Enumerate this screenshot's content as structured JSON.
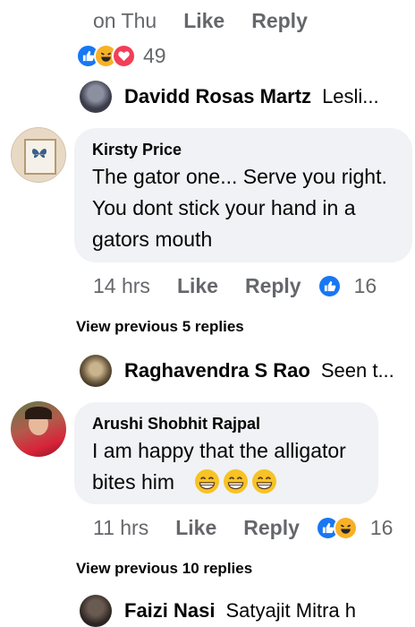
{
  "top_meta": {
    "time": "on Thu",
    "like": "Like",
    "reply": "Reply"
  },
  "top_reactions": {
    "icons": [
      "like-icon",
      "haha-icon",
      "love-icon"
    ],
    "count": "49"
  },
  "reply_preview_1": {
    "author": "Davidd Rosas Martz",
    "text": "Lesli..."
  },
  "comment_1": {
    "author": "Kirsty Price",
    "lines": [
      "The gator one... Serve you right.",
      "You dont stick your hand in a",
      "gators mouth"
    ],
    "time": "14 hrs",
    "like": "Like",
    "reply": "Reply",
    "reactions": {
      "icons": [
        "like-icon"
      ],
      "count": "16"
    }
  },
  "view_prev_1": "View previous 5 replies",
  "reply_preview_2": {
    "author": "Raghavendra S Rao",
    "text": "Seen t..."
  },
  "comment_2": {
    "author": "Arushi Shobhit Rajpal",
    "line1": "I am happy that the alligator",
    "line2": "bites him",
    "emojis": [
      "grin-icon",
      "grin-icon",
      "grin-icon"
    ],
    "time": "11 hrs",
    "like": "Like",
    "reply": "Reply",
    "reactions": {
      "icons": [
        "like-icon",
        "haha-icon"
      ],
      "count": "16"
    }
  },
  "view_prev_2": "View previous 10 replies",
  "reply_preview_3": {
    "author": "Faizi Nasi",
    "text": "Satyajit Mitra h"
  },
  "colors": {
    "like": "#1877f2",
    "haha": "#f7b125",
    "love": "#f33e58",
    "bubble": "#f0f2f5",
    "meta": "#65676b"
  }
}
